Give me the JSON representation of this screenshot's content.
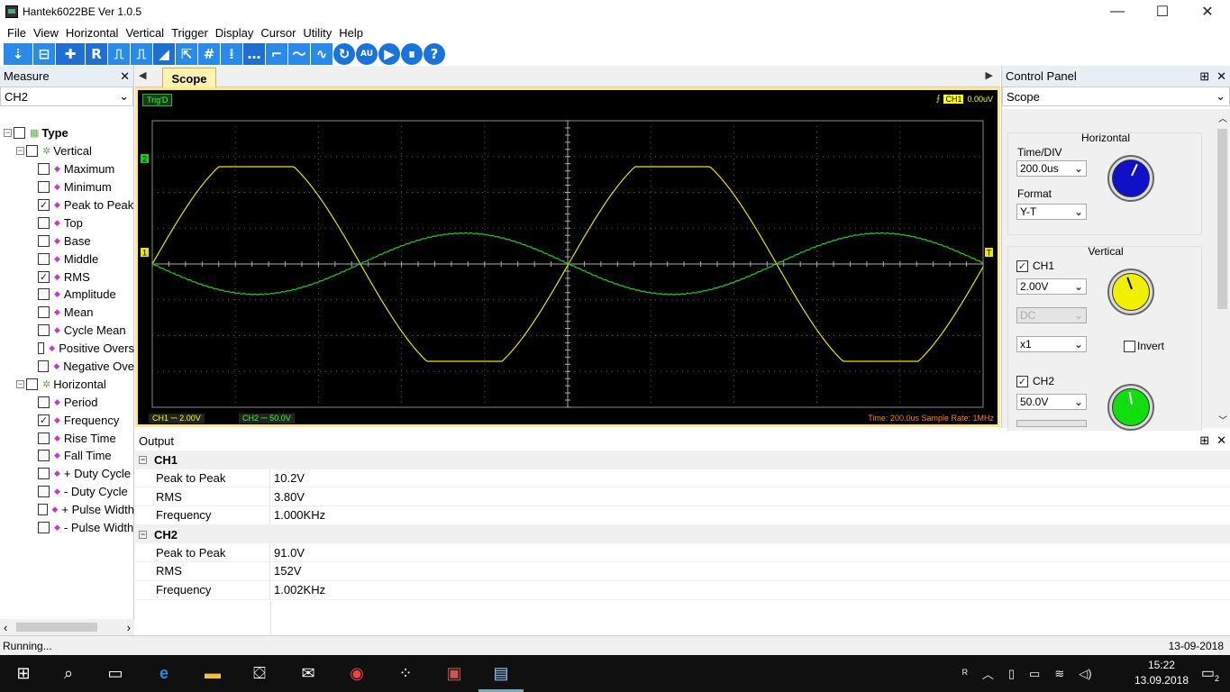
{
  "window": {
    "title": "Hantek6022BE Ver 1.0.5",
    "minimize": "—",
    "maximize": "☐",
    "close": "✕"
  },
  "menu": [
    "File",
    "View",
    "Horizontal",
    "Vertical",
    "Trigger",
    "Display",
    "Cursor",
    "Utility",
    "Help"
  ],
  "toolbar": [
    "⇣",
    "⊟",
    "✚",
    "R",
    "⎍",
    "⎍",
    "◢",
    "⇱",
    "#",
    "⁞",
    "…",
    "⌐",
    "〜",
    "∿",
    "↻",
    "AU",
    "▶",
    "⏸",
    "?"
  ],
  "measure": {
    "title": "Measure",
    "close": "✕",
    "channel": "CH2",
    "tree_root": "Type",
    "vertical_label": "Vertical",
    "vertical_items": [
      {
        "label": "Maximum",
        "checked": false
      },
      {
        "label": "Minimum",
        "checked": false
      },
      {
        "label": "Peak to Peak",
        "checked": true
      },
      {
        "label": "Top",
        "checked": false
      },
      {
        "label": "Base",
        "checked": false
      },
      {
        "label": "Middle",
        "checked": false
      },
      {
        "label": "RMS",
        "checked": true
      },
      {
        "label": "Amplitude",
        "checked": false
      },
      {
        "label": "Mean",
        "checked": false
      },
      {
        "label": "Cycle Mean",
        "checked": false
      },
      {
        "label": "Positive Overs",
        "checked": false
      },
      {
        "label": "Negative Ove",
        "checked": false
      }
    ],
    "horizontal_label": "Horizontal",
    "horizontal_items": [
      {
        "label": "Period",
        "checked": false
      },
      {
        "label": "Frequency",
        "checked": true
      },
      {
        "label": "Rise Time",
        "checked": false
      },
      {
        "label": "Fall Time",
        "checked": false
      },
      {
        "label": "+ Duty Cycle",
        "checked": false
      },
      {
        "label": "- Duty Cycle",
        "checked": false
      },
      {
        "label": "+ Pulse Width",
        "checked": false
      },
      {
        "label": "- Pulse Width",
        "checked": false
      }
    ]
  },
  "scope": {
    "tab": "Scope",
    "trig_state": "Trig'D",
    "trig_channel": "CH1",
    "trig_level": "0.00uV",
    "ch1_marker": "1",
    "ch2_marker": "2",
    "trig_marker": "T",
    "status_ch1": "CH1 ⎓  2.00V",
    "status_ch2": "CH2 ⎓  50.0V",
    "status_time": "Time: 200.0us     Sample Rate: 1MHz",
    "colors": {
      "ch1": "#e6e600",
      "ch2": "#22cc22",
      "grid": "#5a5a5a",
      "bg": "#000000"
    }
  },
  "control_panel": {
    "title": "Control Panel",
    "pin": "⊞",
    "close": "✕",
    "selector": "Scope",
    "horizontal": {
      "title": "Horizontal",
      "time_div_label": "Time/DIV",
      "time_div": "200.0us",
      "format_label": "Format",
      "format": "Y-T"
    },
    "vertical": {
      "title": "Vertical",
      "ch1": {
        "label": "CH1",
        "enabled": true,
        "volts": "2.00V",
        "coupling": "DC",
        "probe": "x1",
        "invert_label": "Invert"
      },
      "ch2": {
        "label": "CH2",
        "enabled": true,
        "volts": "50.0V"
      }
    },
    "knob_colors": {
      "horizontal": "#1010c8",
      "ch1": "#f0f000",
      "ch2": "#11dd11"
    }
  },
  "output": {
    "title": "Output",
    "pin": "⊞",
    "close": "✕",
    "groups": [
      {
        "name": "CH1",
        "rows": [
          {
            "name": "Peak to Peak",
            "value": "10.2V"
          },
          {
            "name": "RMS",
            "value": "3.80V"
          },
          {
            "name": "Frequency",
            "value": "1.000KHz"
          }
        ]
      },
      {
        "name": "CH2",
        "rows": [
          {
            "name": "Peak to Peak",
            "value": "91.0V"
          },
          {
            "name": "RMS",
            "value": "152V"
          },
          {
            "name": "Frequency",
            "value": "1.002KHz"
          }
        ]
      }
    ]
  },
  "status": {
    "left": "Running...",
    "right": "13-09-2018"
  },
  "taskbar": {
    "time": "15:22",
    "date": "13.09.2018",
    "notifications": "2"
  }
}
